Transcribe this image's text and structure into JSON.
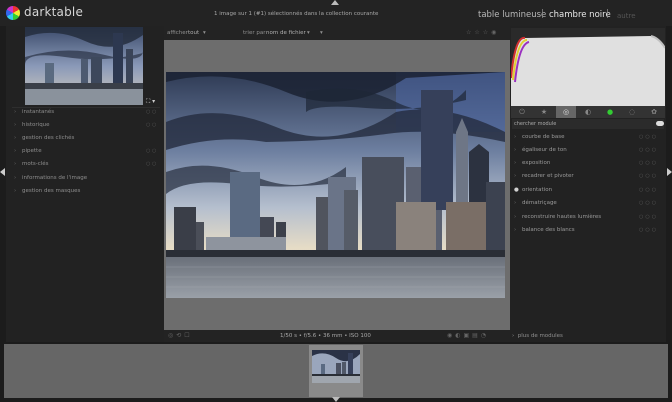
{
  "app": {
    "name": "darktable"
  },
  "status": {
    "text": "1 image sur 1 (#1) sélectionnés dans la collection courante"
  },
  "views": {
    "lighttable": "table lumineuse",
    "darkroom": "chambre noire",
    "more": "autre"
  },
  "center_toolbar": {
    "show_label": "afficher",
    "show_value": "tout",
    "sort_label": "trier par",
    "sort_value": "nom de fichier"
  },
  "left_panel": {
    "items": [
      {
        "label": "instantanés"
      },
      {
        "label": "historique"
      },
      {
        "label": "gestion des clichés"
      },
      {
        "label": "pipette"
      },
      {
        "label": "mots-clés"
      },
      {
        "label": "informations de l'image"
      },
      {
        "label": "gestion des masques"
      }
    ]
  },
  "right_panel": {
    "search_label": "chercher module",
    "modules": [
      {
        "label": "courbe de base"
      },
      {
        "label": "égaliseur de ton"
      },
      {
        "label": "exposition"
      },
      {
        "label": "recadrer et pivoter"
      },
      {
        "label": "orientation"
      },
      {
        "label": "dématriçage"
      },
      {
        "label": "reconstruire hautes lumières"
      },
      {
        "label": "balance des blancs"
      }
    ],
    "more_modules": "plus de modules"
  },
  "bottom": {
    "exif": "1/50 s • f/5.6 • 36 mm • ISO 100"
  },
  "colors": {
    "panel": "#222222",
    "center_bg": "#6d6d6d",
    "filmstrip": "#666666",
    "accent": "#dddddd"
  },
  "icons": {
    "logo": "darktable-logo-icon",
    "nav": "zoom-icon",
    "search_toggle": "toggle-icon"
  }
}
